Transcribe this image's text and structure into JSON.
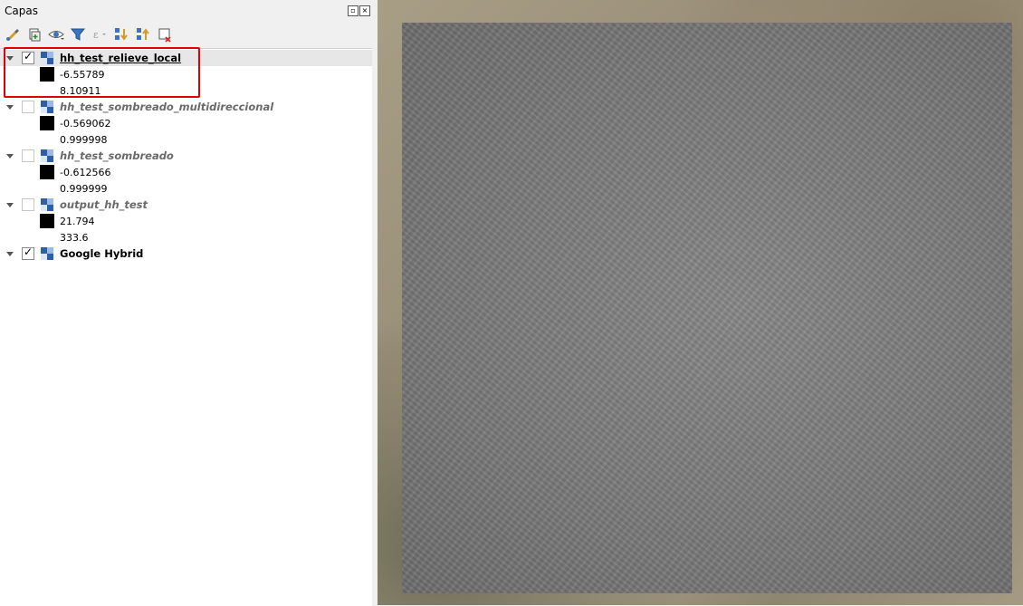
{
  "panel": {
    "title": "Capas",
    "float_icon": "float-icon",
    "close_icon": "close-icon"
  },
  "toolbar": {
    "buttons": [
      "style-manager-icon",
      "add-group-icon",
      "visibility-eye-icon",
      "filter-icon",
      "expression-filter-icon",
      "expand-all-icon",
      "collapse-all-icon",
      "remove-layer-icon"
    ]
  },
  "layers": [
    {
      "name": "hh_test_relieve_local",
      "checked": true,
      "min": "-6.55789",
      "max": "8.10911"
    },
    {
      "name": "hh_test_sombreado_multidireccional",
      "checked": false,
      "min": "-0.569062",
      "max": "0.999998"
    },
    {
      "name": "hh_test_sombreado",
      "checked": false,
      "min": "-0.612566",
      "max": "0.999999"
    },
    {
      "name": "output_hh_test",
      "checked": false,
      "min": "21.794",
      "max": "333.6"
    },
    {
      "name": "Google Hybrid",
      "checked": true
    }
  ],
  "colors": {
    "highlight": "#e00000"
  }
}
